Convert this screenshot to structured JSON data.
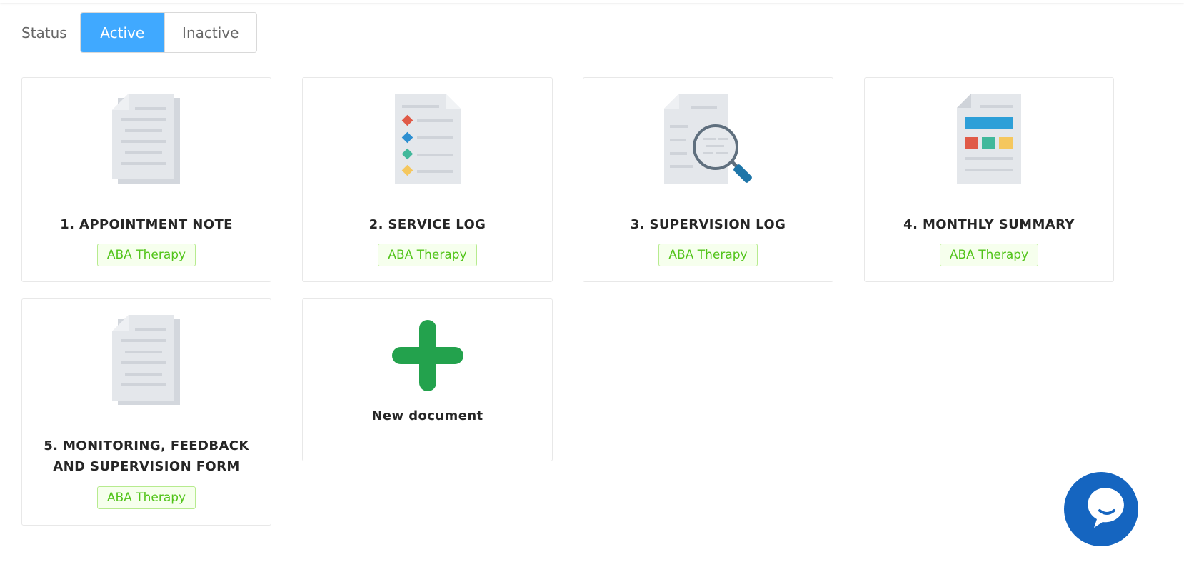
{
  "status": {
    "label": "Status",
    "options": [
      "Active",
      "Inactive"
    ],
    "selected": "Active"
  },
  "documents": [
    {
      "title": "1. APPOINTMENT NOTE",
      "tag": "ABA Therapy",
      "icon": "text-document-icon"
    },
    {
      "title": "2. SERVICE LOG",
      "tag": "ABA Therapy",
      "icon": "checklist-document-icon"
    },
    {
      "title": "3. SUPERVISION LOG",
      "tag": "ABA Therapy",
      "icon": "magnifier-document-icon"
    },
    {
      "title": "4. MONTHLY SUMMARY",
      "tag": "ABA Therapy",
      "icon": "report-document-icon"
    },
    {
      "title": "5. MONITORING, FEEDBACK AND SUPERVISION FORM",
      "tag": "ABA Therapy",
      "icon": "text-document-icon"
    }
  ],
  "new_document": {
    "label": "New document",
    "icon": "plus-icon"
  },
  "chat": {
    "icon": "chat-bubble-icon"
  },
  "colors": {
    "accent": "#40a9ff",
    "tag_text": "#52c41a",
    "tag_bg": "#f6ffed",
    "plus": "#23a24d",
    "chat": "#1565c0"
  }
}
